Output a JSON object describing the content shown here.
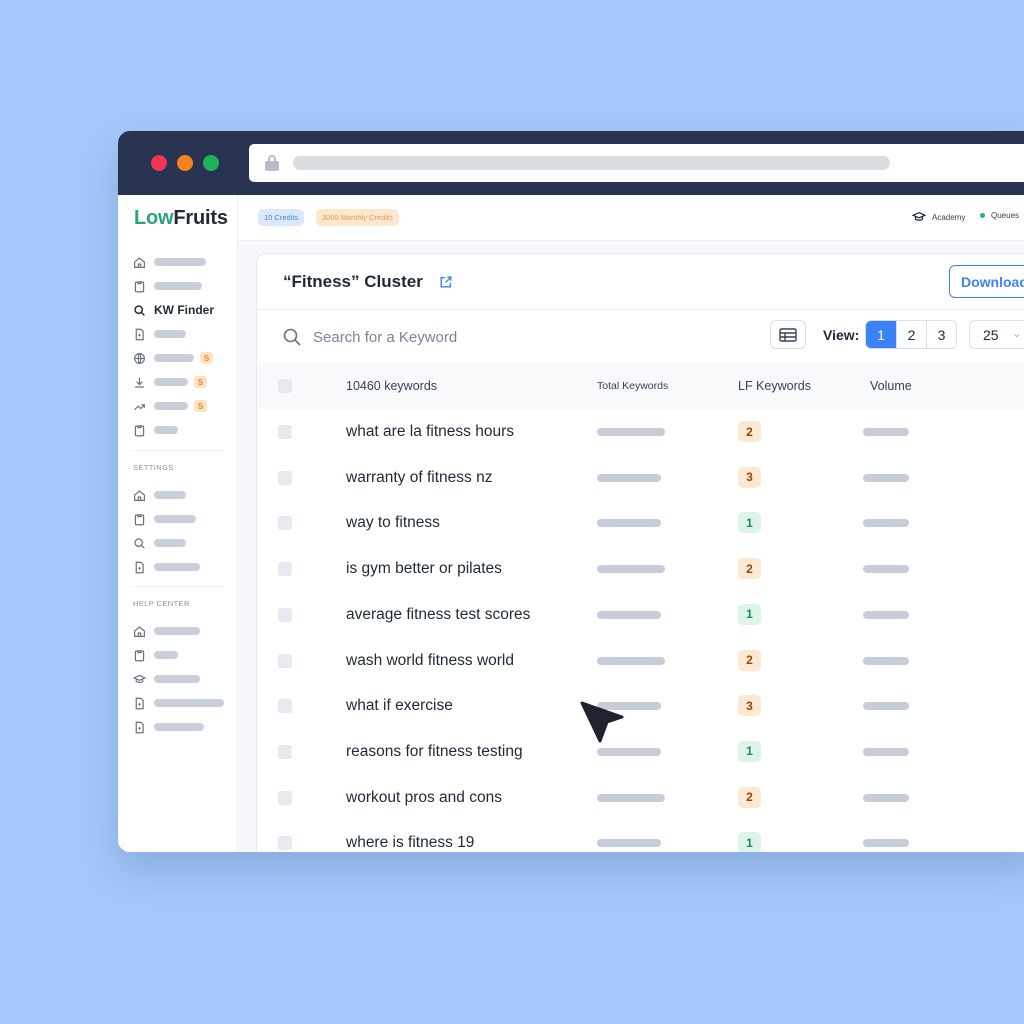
{
  "brand": {
    "logo_low": "Low",
    "logo_fruits": "Fruits"
  },
  "sidebar": {
    "active_item": {
      "label": "KW Finder"
    },
    "settings_heading": "SETTINGS",
    "help_heading": "HELP CENTER",
    "pro_badge": "S"
  },
  "topbar": {
    "credits": "10 Credits",
    "monthly_credits": "3000 Monthly Credits",
    "academy": "Academy",
    "queues": "Queues"
  },
  "cluster": {
    "title": "“Fitness” Cluster",
    "download_label": "Download",
    "search_placeholder": "Search for a Keyword",
    "view_label": "View:",
    "pages": [
      "1",
      "2",
      "3"
    ],
    "active_page": "1",
    "per_page": "25"
  },
  "table": {
    "headers": {
      "keywords": "10460 keywords",
      "total": "Total Keywords",
      "lf": "LF Keywords",
      "volume": "Volume"
    },
    "rows": [
      {
        "keyword": "what are la fitness hours",
        "lf": "2"
      },
      {
        "keyword": "warranty of fitness nz",
        "lf": "3"
      },
      {
        "keyword": "way to fitness",
        "lf": "1"
      },
      {
        "keyword": "is gym better or pilates",
        "lf": "2"
      },
      {
        "keyword": "average fitness test scores",
        "lf": "1"
      },
      {
        "keyword": "wash world fitness world",
        "lf": "2"
      },
      {
        "keyword": "what if exercise",
        "lf": "3"
      },
      {
        "keyword": "reasons for fitness testing",
        "lf": "1"
      },
      {
        "keyword": "workout pros and cons",
        "lf": "2"
      },
      {
        "keyword": "where is fitness 19",
        "lf": "1"
      }
    ]
  },
  "colors": {
    "background": "#a4c8fb",
    "titlebar": "#283352",
    "accent": "#3b82f6",
    "brand_green": "#2aa37a",
    "badge_orange_bg": "#fde8d2",
    "badge_green_bg": "#dcf5e8"
  }
}
